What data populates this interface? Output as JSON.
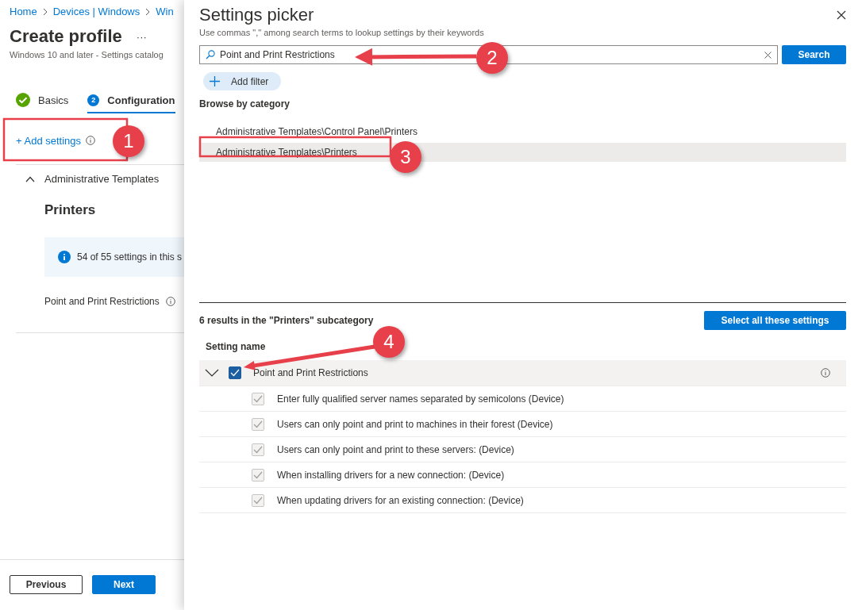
{
  "breadcrumb": [
    "Home",
    "Devices | Windows",
    "Win"
  ],
  "page": {
    "title": "Create profile",
    "more": "···",
    "subtitle": "Windows 10 and later - Settings catalog"
  },
  "steps": [
    {
      "label": "Basics",
      "done": true,
      "selected": false
    },
    {
      "label": "Configuration",
      "number": "2",
      "done": false,
      "selected": true
    }
  ],
  "add_settings": "+ Add settings",
  "section": {
    "title": "Administrative Templates",
    "expanded": true,
    "heading": "Printers",
    "info": "54 of 55 settings in this s",
    "settings": [
      "Point and Print Restrictions"
    ]
  },
  "footer_buttons": [
    {
      "label": "Previous",
      "primary": false
    },
    {
      "label": "Next",
      "primary": true
    }
  ],
  "picker": {
    "title": "Settings picker",
    "hint": "Use commas \",\" among search terms to lookup settings by their keywords",
    "search": {
      "value": "Point and Print Restrictions"
    },
    "search_button": "Search",
    "add_filter": "Add filter",
    "browse_heading": "Browse by category",
    "categories": [
      {
        "label": "Administrative Templates\\Control Panel\\Printers",
        "selected": false
      },
      {
        "label": "Administrative Templates\\Printers",
        "selected": true
      }
    ],
    "results_text": "6 results in the \"Printers\" subcategory",
    "select_all": "Select all these settings",
    "column": "Setting name",
    "settings": [
      {
        "label": "Point and Print Restrictions",
        "checked": true,
        "expanded": true,
        "children": [
          {
            "label": "Enter fully qualified server names separated by semicolons (Device)",
            "checked": true,
            "disabled": true
          },
          {
            "label": "Users can only point and print to machines in their forest (Device)",
            "checked": true,
            "disabled": true
          },
          {
            "label": "Users can only point and print to these servers: (Device)",
            "checked": true,
            "disabled": true
          },
          {
            "label": "When installing drivers for a new connection: (Device)",
            "checked": true,
            "disabled": true
          },
          {
            "label": "When updating drivers for an existing connection: (Device)",
            "checked": true,
            "disabled": true
          }
        ]
      }
    ]
  },
  "callouts": [
    {
      "number": "1"
    },
    {
      "number": "2"
    },
    {
      "number": "3"
    },
    {
      "number": "4"
    }
  ]
}
